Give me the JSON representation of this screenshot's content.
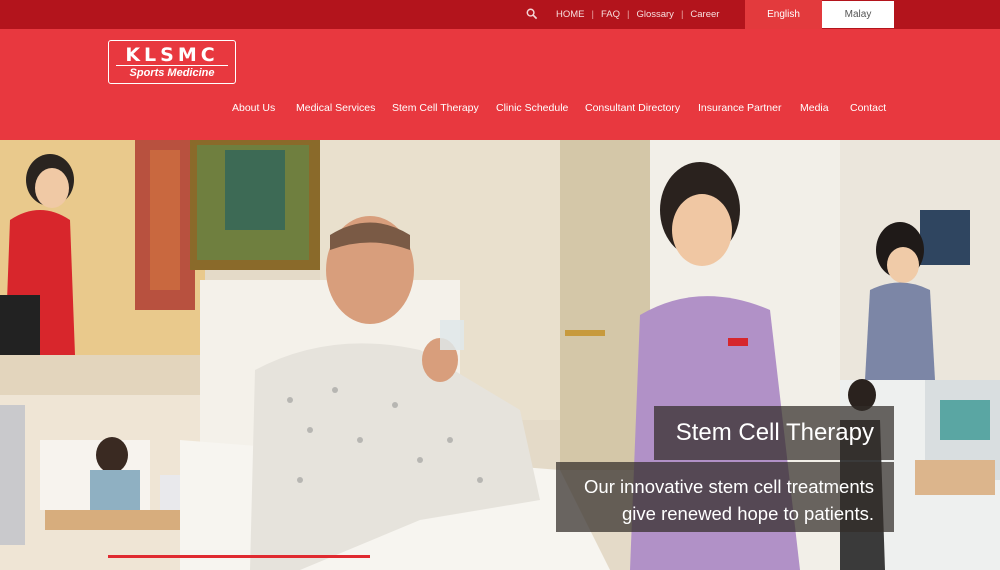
{
  "utility": {
    "search_icon": "search-icon",
    "links": [
      "HOME",
      "FAQ",
      "Glossary",
      "Career"
    ],
    "lang_english": "English",
    "lang_malay": "Malay"
  },
  "brand": {
    "line1": "KLSMC",
    "line2": "Sports Medicine"
  },
  "nav": [
    "About Us",
    "Medical Services",
    "Stem Cell Therapy",
    "Clinic Schedule",
    "Consultant Directory",
    "Insurance Partner",
    "Media",
    "Contact"
  ],
  "hero": {
    "title": "Stem Cell Therapy",
    "subtitle_line1": "Our innovative stem cell treatments",
    "subtitle_line2": "give renewed hope to patients."
  },
  "colors": {
    "topbar": "#b3141c",
    "header": "#e8383f",
    "active_lang": "#e33a3d",
    "accent": "#e02a30"
  }
}
